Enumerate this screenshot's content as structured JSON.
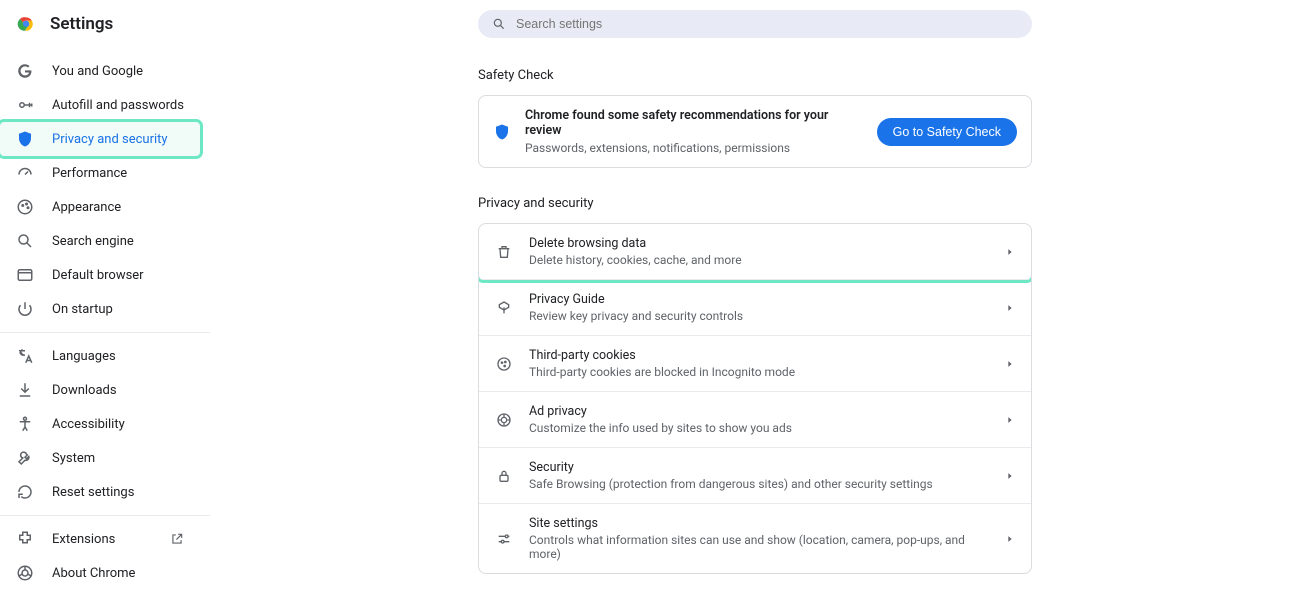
{
  "brand": {
    "title": "Settings"
  },
  "search": {
    "placeholder": "Search settings"
  },
  "sidebar": {
    "group1": [
      {
        "label": "You and Google"
      },
      {
        "label": "Autofill and passwords"
      },
      {
        "label": "Privacy and security"
      },
      {
        "label": "Performance"
      },
      {
        "label": "Appearance"
      },
      {
        "label": "Search engine"
      },
      {
        "label": "Default browser"
      },
      {
        "label": "On startup"
      }
    ],
    "group2": [
      {
        "label": "Languages"
      },
      {
        "label": "Downloads"
      },
      {
        "label": "Accessibility"
      },
      {
        "label": "System"
      },
      {
        "label": "Reset settings"
      }
    ],
    "group3": [
      {
        "label": "Extensions"
      },
      {
        "label": "About Chrome"
      }
    ]
  },
  "safety": {
    "section_label": "Safety Check",
    "title": "Chrome found some safety recommendations for your review",
    "sub": "Passwords, extensions, notifications, permissions",
    "button": "Go to Safety Check"
  },
  "privacy": {
    "section_label": "Privacy and security",
    "rows": [
      {
        "title": "Delete browsing data",
        "sub": "Delete history, cookies, cache, and more"
      },
      {
        "title": "Privacy Guide",
        "sub": "Review key privacy and security controls"
      },
      {
        "title": "Third-party cookies",
        "sub": "Third-party cookies are blocked in Incognito mode"
      },
      {
        "title": "Ad privacy",
        "sub": "Customize the info used by sites to show you ads"
      },
      {
        "title": "Security",
        "sub": "Safe Browsing (protection from dangerous sites) and other security settings"
      },
      {
        "title": "Site settings",
        "sub": "Controls what information sites can use and show (location, camera, pop-ups, and more)"
      }
    ]
  }
}
